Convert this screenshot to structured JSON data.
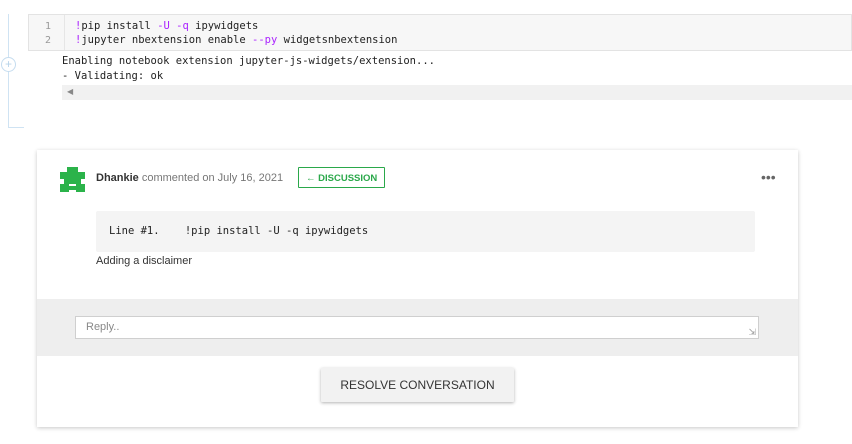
{
  "notebook_cell": {
    "line_numbers": [
      "1",
      "2"
    ],
    "code_lines": [
      {
        "prefix": "!",
        "text": "pip install ",
        "flags": "-U -q",
        "rest": " ipywidgets"
      },
      {
        "prefix": "!",
        "text": "jupyter nbextension enable ",
        "flags": "--py",
        "rest": " widgetsnbextension"
      }
    ],
    "output_lines": [
      "Enabling notebook extension jupyter-js-widgets/extension...",
      "- Validating: ok"
    ],
    "add_cell_icon": "plus-circle-icon",
    "scroll_icon": "caret-left-icon"
  },
  "comment": {
    "author": "Dhankie",
    "meta": " commented on July 16, 2021",
    "tag_label": "← DISCUSSION",
    "more_icon": "more-options-icon",
    "quoted_line": "Line #1.    !pip install -U -q ipywidgets",
    "body": "Adding a disclaimer",
    "reply_placeholder": "Reply..",
    "resolve_label": "RESOLVE CONVERSATION",
    "accent_color": "#2aa84a"
  }
}
